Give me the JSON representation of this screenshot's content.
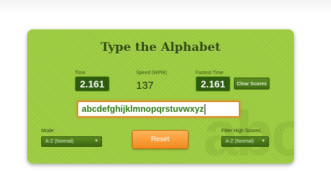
{
  "game": {
    "title": "Type the Alphabet",
    "watermark": "abc",
    "time_label": "Time",
    "time_value": "2.161",
    "speed_label": "Speed (WPM)",
    "speed_value": "137",
    "fastest_label": "Fastest Time",
    "fastest_value": "2.161",
    "clear_scores_label": "Clear Scores",
    "typed_text": "abcdefghijklmnopqrstuvwxyz",
    "mode_label": "Mode:",
    "mode_selected": "A-Z (Normal)",
    "reset_label": "Reset",
    "filter_label": "Filter High Scores:",
    "filter_selected": "A-Z (Normal)"
  },
  "colors": {
    "card_bg": "#9ccd3e",
    "stat_box": "#2d5c0c",
    "typed_text": "#2a7a12",
    "reset_button": "#f28a1f"
  },
  "icons": {
    "select_arrow": "caret-down-icon"
  }
}
